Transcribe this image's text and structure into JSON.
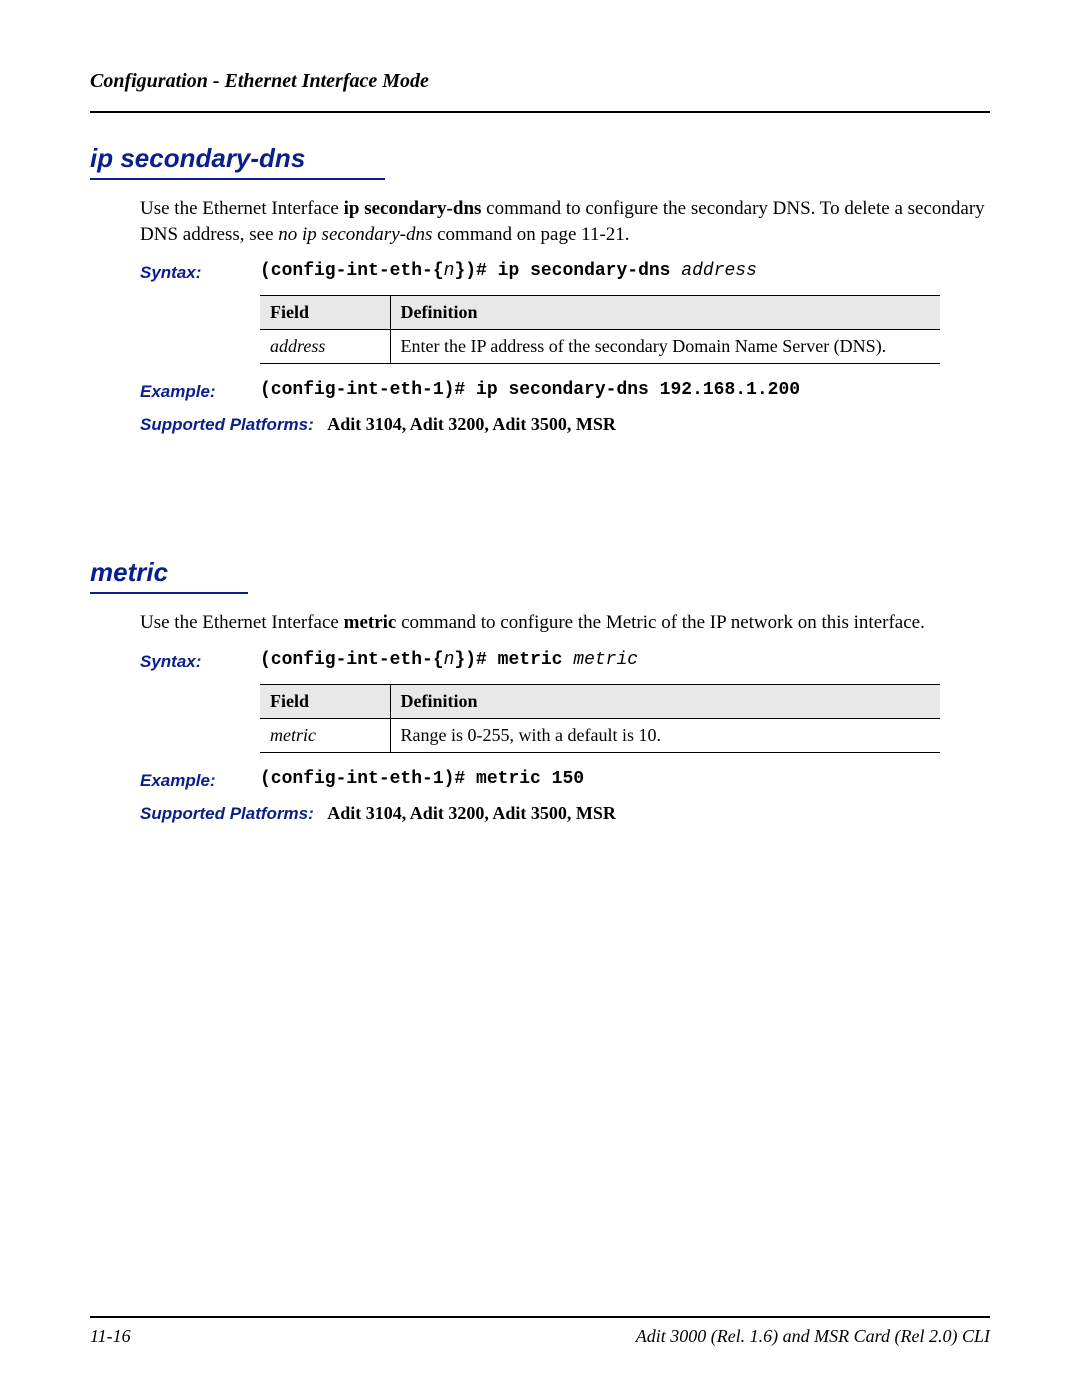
{
  "header": {
    "title": "Configuration - Ethernet Interface Mode"
  },
  "sections": [
    {
      "title": "ip secondary-dns",
      "body_pre": "Use the Ethernet Interface ",
      "body_cmd": "ip secondary-dns",
      "body_mid": " command to configure the secondary DNS. To delete a secondary DNS address, see ",
      "body_italic": "no ip secondary-dns",
      "body_post": " command on page 11-21.",
      "syntax_label": "Syntax:",
      "syntax_prefix": "(config-int-eth-{",
      "syntax_n": "n",
      "syntax_mid": "})# ip secondary-dns ",
      "syntax_arg": "address",
      "table": {
        "h1": "Field",
        "h2": "Definition",
        "r1c1": "address",
        "r1c2": "Enter the IP address of the secondary Domain Name Server (DNS)."
      },
      "example_label": "Example:",
      "example_text": "(config-int-eth-1)# ip secondary-dns 192.168.1.200",
      "platforms_label": "Supported Platforms:",
      "platforms_value": "Adit 3104, Adit 3200, Adit 3500, MSR"
    },
    {
      "title": "metric",
      "body_pre": "Use the Ethernet Interface ",
      "body_cmd": "metric",
      "body_mid": " command to configure the  Metric of the IP network on this interface.",
      "syntax_label": "Syntax:",
      "syntax_prefix": "(config-int-eth-{",
      "syntax_n": "n",
      "syntax_mid": "})# metric ",
      "syntax_arg": "metric",
      "table": {
        "h1": "Field",
        "h2": "Definition",
        "r1c1": "metric",
        "r1c2": "Range is 0-255, with a default is 10."
      },
      "example_label": "Example:",
      "example_text": "(config-int-eth-1)# metric 150",
      "platforms_label": "Supported Platforms:",
      "platforms_value": "Adit 3104, Adit 3200, Adit 3500, MSR"
    }
  ],
  "footer": {
    "left": "11-16",
    "right": "Adit 3000 (Rel. 1.6) and MSR Card (Rel 2.0) CLI"
  }
}
